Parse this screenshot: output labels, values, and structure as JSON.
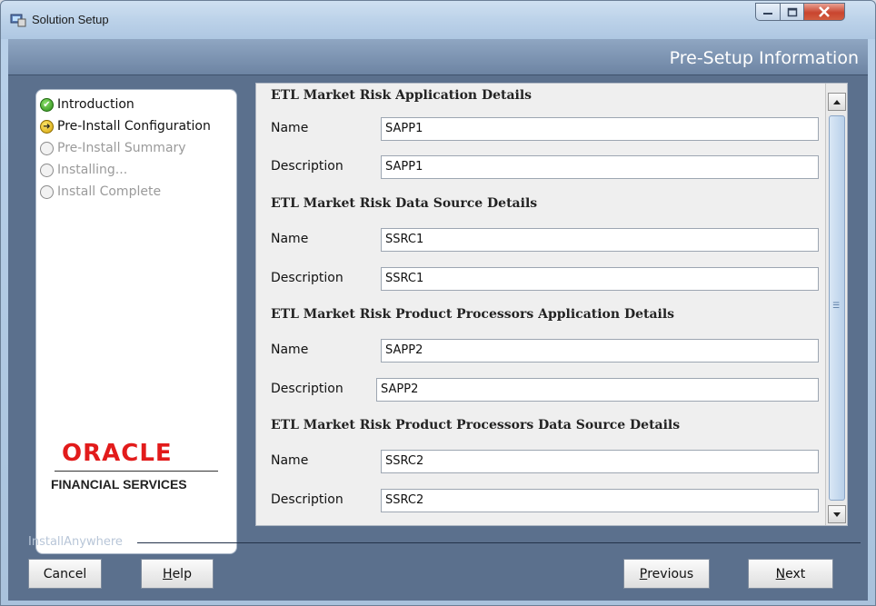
{
  "window": {
    "title": "Solution Setup"
  },
  "header": {
    "title": "Pre-Setup Information"
  },
  "steps": [
    {
      "label": "Introduction",
      "state": "done"
    },
    {
      "label": "Pre-Install Configuration",
      "state": "current"
    },
    {
      "label": "Pre-Install Summary",
      "state": "pending"
    },
    {
      "label": "Installing...",
      "state": "pending"
    },
    {
      "label": "Install Complete",
      "state": "pending"
    }
  ],
  "logo": {
    "brand": "ORACLE",
    "tagline": "FINANCIAL SERVICES"
  },
  "form": {
    "sections": [
      {
        "title": "ETL Market Risk Application Details",
        "name_label": "Name",
        "name_value": "SAPP1",
        "desc_label": "Description",
        "desc_value": "SAPP1"
      },
      {
        "title": "ETL Market Risk Data Source Details",
        "name_label": "Name",
        "name_value": "SSRC1",
        "desc_label": "Description",
        "desc_value": "SSRC1"
      },
      {
        "title": "ETL Market Risk Product Processors Application Details",
        "name_label": "Name",
        "name_value": "SAPP2",
        "desc_label": "Description",
        "desc_value": "SAPP2"
      },
      {
        "title": "ETL Market Risk Product Processors Data Source Details",
        "name_label": "Name",
        "name_value": "SSRC2",
        "desc_label": "Description",
        "desc_value": "SSRC2"
      }
    ]
  },
  "footer": {
    "brand_label": "InstallAnywhere",
    "cancel": "Cancel",
    "help_prefix": "",
    "help_mnemonic": "H",
    "help_rest": "elp",
    "previous_mnemonic": "P",
    "previous_rest": "revious",
    "next_mnemonic": "N",
    "next_rest": "ext"
  },
  "colors": {
    "accent": "#5b708d",
    "oracle_red": "#e21b1b"
  }
}
